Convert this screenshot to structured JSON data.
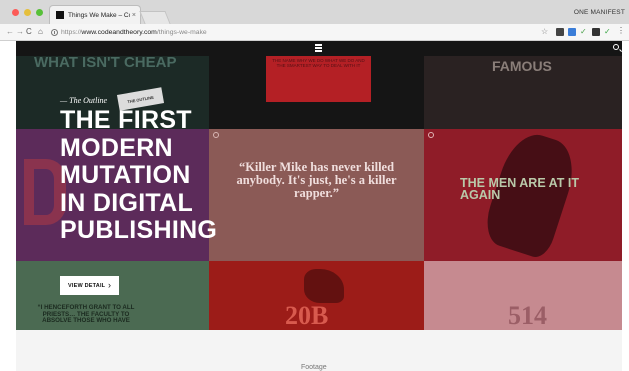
{
  "browser": {
    "tab_title": "Things We Make – Code and Th",
    "tab_close": "×",
    "profile_name": "ONE MANIFEST",
    "url_scheme": "https://",
    "url_domain": "www.codeandtheory.com",
    "url_path": "/things-we-make",
    "nav": {
      "back": "←",
      "forward": "→",
      "reload": "C",
      "home": "⌂"
    },
    "star": "☆",
    "menu": "⋮"
  },
  "site": {
    "menu_icon": "hamburger-icon",
    "search_icon": "search-icon"
  },
  "tiles": {
    "t1_text": "WHAT ISN'T CHEAP",
    "t2_text": "THE NAME WHY WE DO WHAT WE DO AND THE SMARTEST WAY TO DEAL WITH IT",
    "t3_text": "FAMOUS",
    "t5_quote": "“Killer Mike has never killed anybody. It's just, he's a killer rapper.”",
    "t6_title": "THE MEN ARE AT IT AGAIN",
    "t7_text": "“I HENCEFORTH GRANT TO ALL PRIESTS… THE FACULTY TO ABSOLVE THOSE WHO HAVE",
    "t8_num": "20B",
    "t9_num": "514"
  },
  "feature": {
    "kicker": "— The Outline",
    "sticker": "The Outline",
    "headline": "THE FIRST MODERN MUTATION IN DIGITAL PUBLISHING",
    "cta_label": "VIEW DETAIL",
    "cta_arrow": "›"
  },
  "footer": {
    "label": "Footage"
  }
}
